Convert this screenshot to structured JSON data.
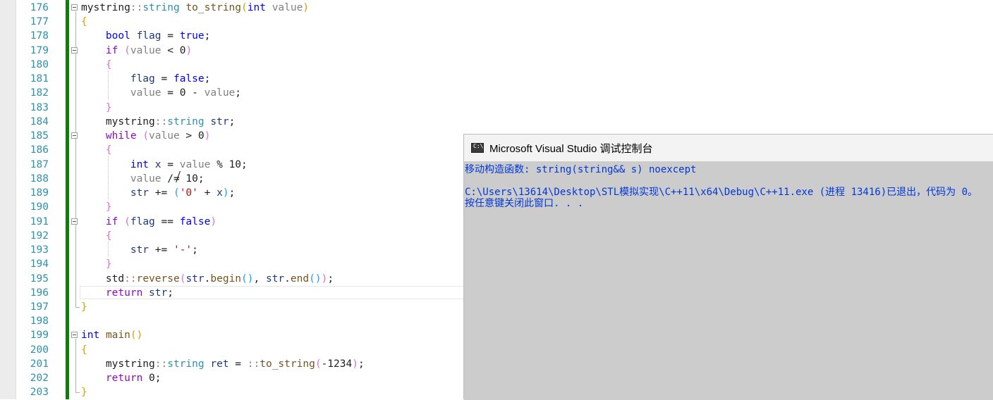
{
  "editor": {
    "line_numbers": [
      "176",
      "177",
      "178",
      "179",
      "180",
      "181",
      "182",
      "183",
      "184",
      "185",
      "186",
      "187",
      "188",
      "189",
      "190",
      "191",
      "192",
      "193",
      "194",
      "195",
      "196",
      "197",
      "198",
      "199",
      "200",
      "201",
      "202",
      "203"
    ],
    "tokens": {
      "mystring": "mystring",
      "scope": "::",
      "string": "string",
      "to_string": "to_string",
      "int": "int",
      "value": "value",
      "bool": "bool",
      "flag": "flag",
      "true": "true",
      "false": "false",
      "if": "if",
      "while": "while",
      "str": "str",
      "x": "x",
      "std": "std",
      "reverse": "reverse",
      "begin": "begin",
      "end": "end",
      "return": "return",
      "main": "main",
      "ret": "ret",
      "char0": "'0'",
      "charminus": "'-'",
      "zero": "0",
      "ten": "10",
      "neg1234": "-1234",
      "lparen": "(",
      "rparen": ")",
      "lbrace": "{",
      "rbrace": "}"
    }
  },
  "console": {
    "title": "Microsoft Visual Studio 调试控制台",
    "icon": "console-app-icon",
    "lines": [
      "移动构造函数: string(string&& s) noexcept",
      "",
      "C:\\Users\\13614\\Desktop\\STL模拟实现\\C++11\\x64\\Debug\\C++11.exe (进程 13416)已退出，代码为 0。",
      "按任意键关闭此窗口. . ."
    ]
  },
  "colors": {
    "keyword": "#0000ff",
    "control_keyword": "#8f08c4",
    "type": "#2b91af",
    "function": "#74531f",
    "char_literal": "#a31515",
    "change_bar": "#107c10",
    "console_text": "#0037da",
    "console_bg": "#cccccc"
  }
}
